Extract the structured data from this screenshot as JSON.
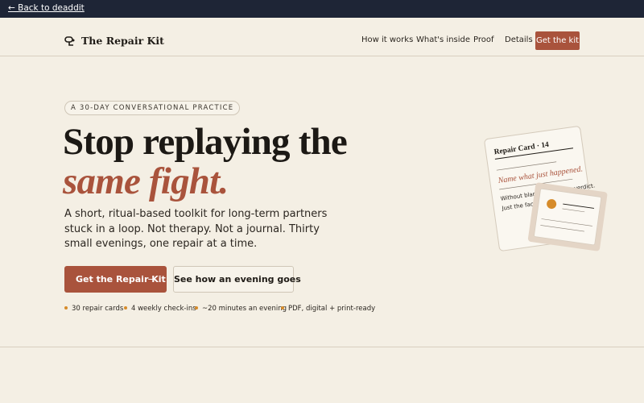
{
  "topbar": {
    "back_link": "← Back to deaddit"
  },
  "header": {
    "brand": "The Repair Kit",
    "nav": [
      "How it works",
      "What's inside",
      "Proof",
      "Details"
    ],
    "cta": "Get the kit"
  },
  "hero": {
    "eyebrow": "A 30-DAY CONVERSATIONAL PRACTICE",
    "headline": "Stop replaying the",
    "headline_accent": "same fight.",
    "lede": "A short, ritual-based toolkit for long-term partners stuck in a loop. Not therapy. Not a journal. Thirty small evenings, one repair at a time.",
    "primary_button": "Get the Repair Kit",
    "secondary_button": "See how an evening goes",
    "features": [
      "30 repair cards",
      "4 weekly check-ins",
      "~20 minutes an evening",
      "PDF, digital + print-ready"
    ]
  },
  "card": {
    "title": "Repair Card · 14",
    "prompt": "Name what just happened.",
    "body_line1": "Without blame. Without a verdict.",
    "body_line2": "Just the facts."
  },
  "colors": {
    "accent": "#a9533c",
    "bullet": "#d68b2a",
    "topbar": "#1e2536",
    "background": "#f4efe4"
  },
  "icons": {
    "brand": "kit-logo-icon",
    "button_arrow": "arrow-right-icon"
  }
}
